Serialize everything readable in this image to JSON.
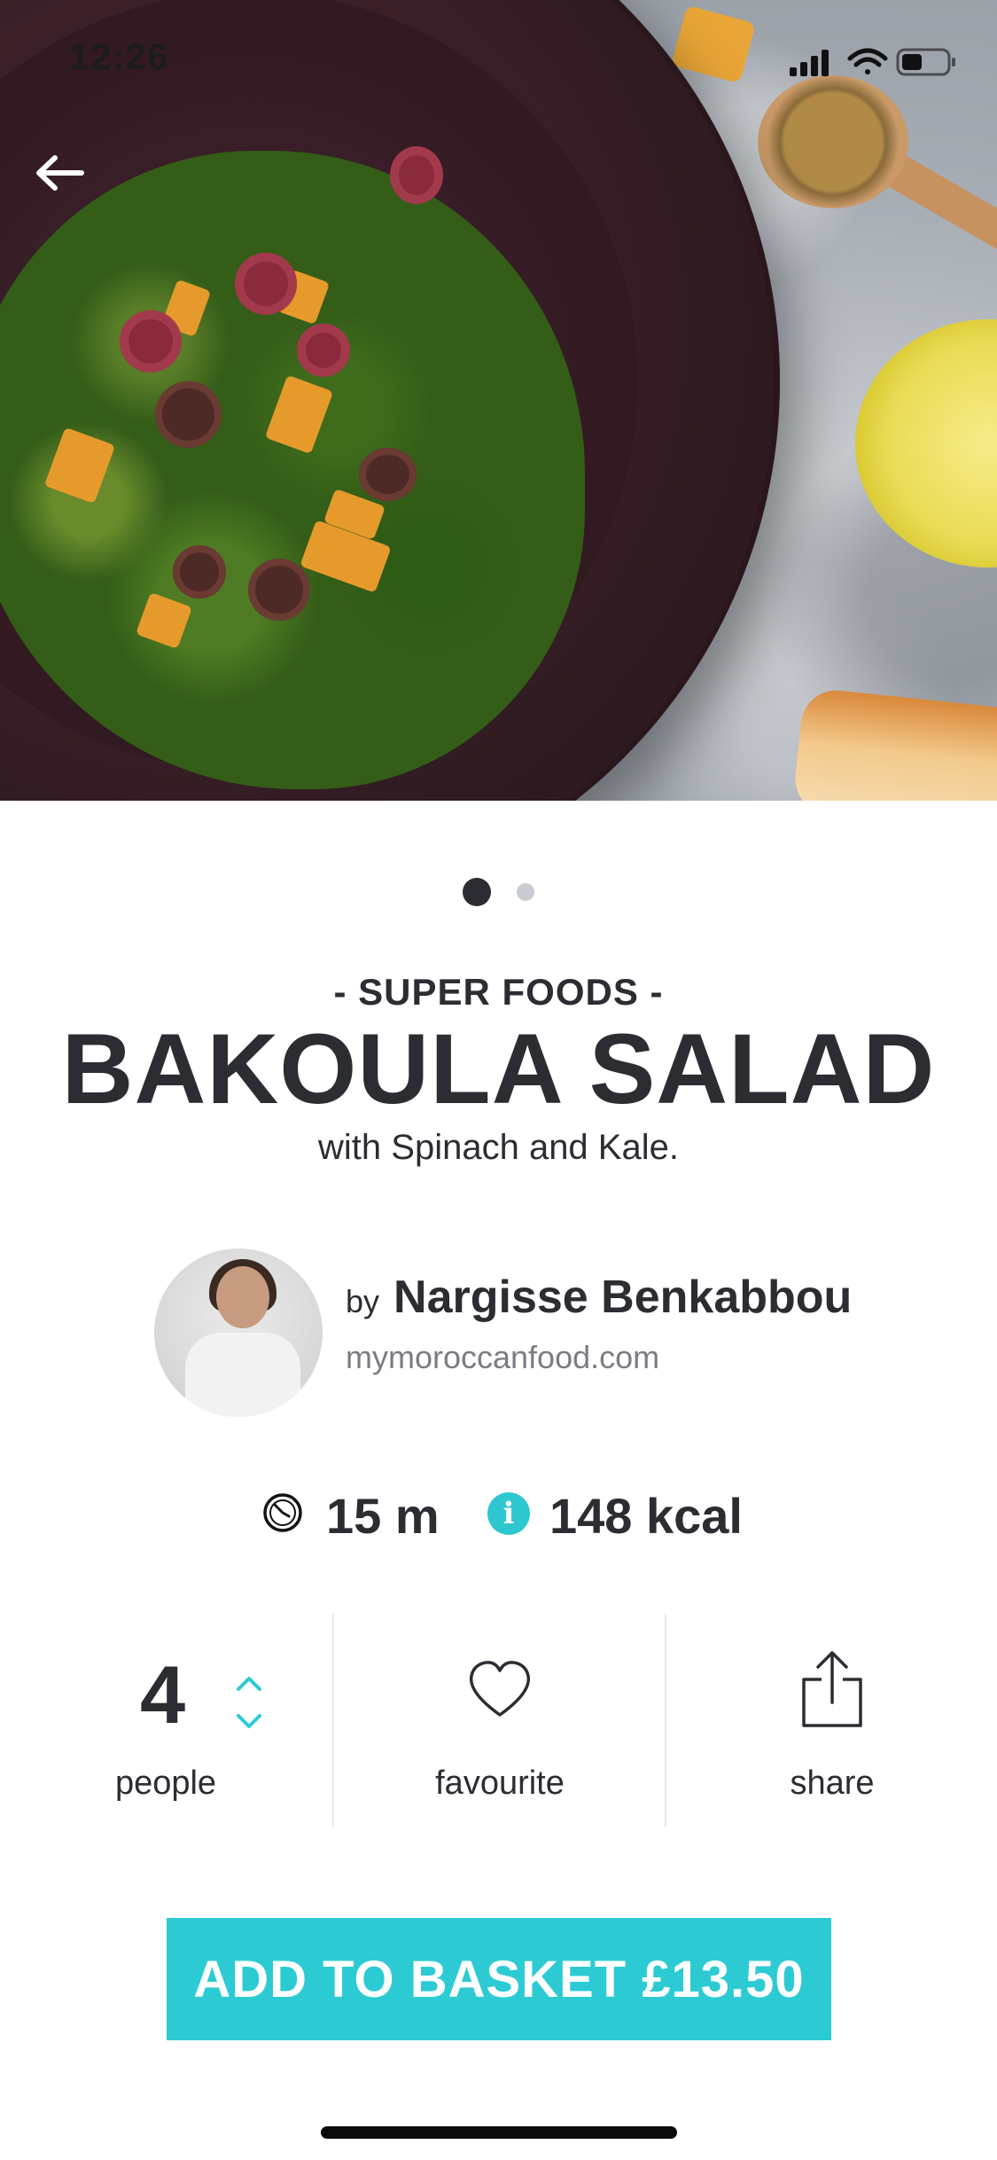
{
  "status_bar": {
    "time": "12:26"
  },
  "hero": {
    "pagination": {
      "count": 2,
      "active_index": 0
    }
  },
  "recipe": {
    "category": "- SUPER FOODS -",
    "title": "BAKOULA SALAD",
    "subtitle": "with Spinach and Kale."
  },
  "author": {
    "prefix": "by",
    "name": "Nargisse Benkabbou",
    "website": "mymoroccanfood.com"
  },
  "meta": {
    "time": "15 m",
    "calories": "148 kcal",
    "info_glyph": "i"
  },
  "actions": {
    "people_count": "4",
    "people_label": "people",
    "favourite_label": "favourite",
    "share_label": "share"
  },
  "cta": {
    "label": "ADD TO BASKET £13.50"
  },
  "colors": {
    "accent": "#2ccbd4",
    "text": "#2b2d33",
    "muted": "#7a7d82"
  }
}
